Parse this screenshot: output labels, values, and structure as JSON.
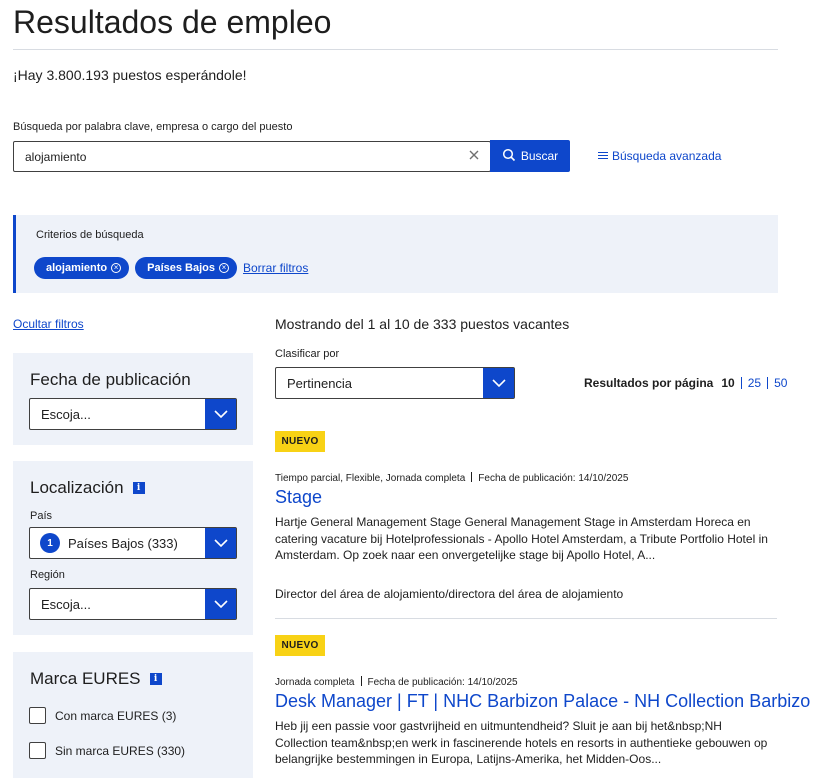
{
  "page": {
    "title": "Resultados de empleo",
    "subtitle": "¡Hay 3.800.193 puestos esperándole!"
  },
  "search": {
    "label": "Búsqueda por palabra clave, empresa o cargo del puesto",
    "value": "alojamiento",
    "button_label": "Buscar",
    "advanced_label": "Búsqueda avanzada"
  },
  "criteria": {
    "title": "Criterios de búsqueda",
    "chips": [
      "alojamiento",
      "Países Bajos"
    ],
    "clear_label": "Borrar filtros"
  },
  "filters": {
    "hide_label": "Ocultar filtros",
    "date": {
      "title": "Fecha de publicación",
      "selected": "Escoja..."
    },
    "location": {
      "title": "Localización",
      "info": "i",
      "country_label": "País",
      "country_count_badge": "1",
      "country_selected": "Países Bajos (333)",
      "region_label": "Región",
      "region_selected": "Escoja..."
    },
    "eures": {
      "title": "Marca EURES",
      "info": "i",
      "options": [
        "Con marca EURES (3)",
        "Sin marca EURES (330)"
      ]
    }
  },
  "results": {
    "summary": "Mostrando del 1 al 10 de 333 puestos vacantes",
    "sort_label": "Clasificar por",
    "sort_selected": "Pertinencia",
    "per_page_label": "Resultados por página",
    "per_page_options": [
      "10",
      "25",
      "50"
    ],
    "per_page_current": "10"
  },
  "jobs": [
    {
      "badge": "NUEVO",
      "schedule": "Tiempo parcial, Flexible, Jornada completa",
      "date": "Fecha de publicación: 14/10/2025",
      "title": "Stage",
      "description": "Hartje General Management Stage General Management Stage in Amsterdam Horeca en catering vacature bij Hotelprofessionals - Apollo Hotel Amsterdam, a Tribute Portfolio Hotel in Amsterdam. Op zoek naar een onvergetelijke stage bij Apollo Hotel, A...",
      "occupation": "Director del área de alojamiento/directora del área de alojamiento"
    },
    {
      "badge": "NUEVO",
      "schedule": "Jornada completa",
      "date": "Fecha de publicación: 14/10/2025",
      "title": "Desk Manager | FT | NHC Barbizon Palace - NH Collection Barbizo",
      "description": "Heb jij een passie voor gastvrijheid en uitmuntendheid? Sluit je aan bij het&nbsp;NH Collection team&nbsp;en werk in fascinerende hotels en resorts in authentieke gebouwen op belangrijke bestemmingen in Europa, Latijns-Amerika, het Midden-Oos..."
    }
  ],
  "colors": {
    "primary": "#0e47cb",
    "panel": "#eef2f9",
    "new_badge": "#f8d215",
    "text": "#1e1e1e"
  }
}
